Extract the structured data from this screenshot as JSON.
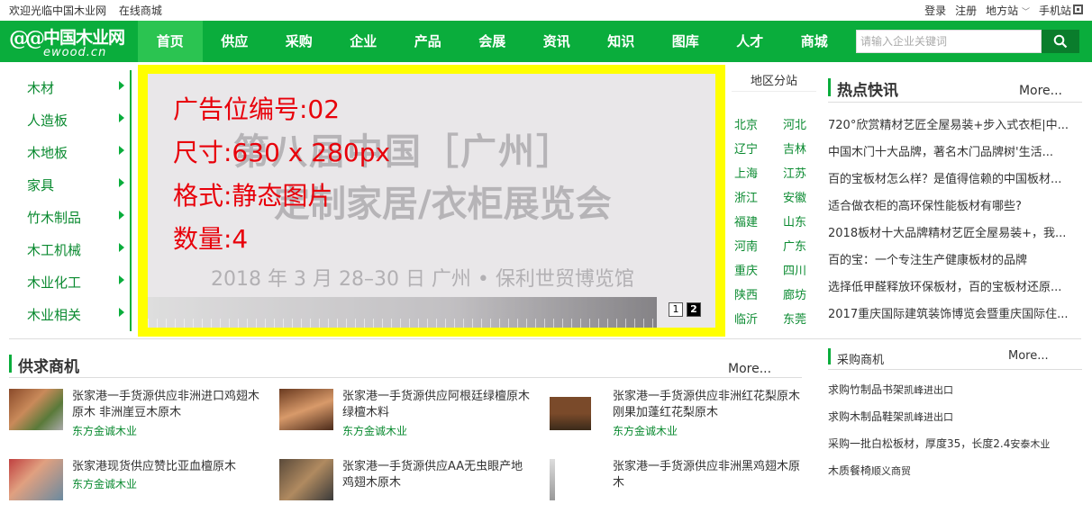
{
  "topbar": {
    "welcome": "欢迎光临中国木业网",
    "mall": "在线商城",
    "login": "登录",
    "register": "注册",
    "region": "地方站",
    "mobile": "手机站"
  },
  "logo": {
    "cn": "中国木业网",
    "en": "ewood.cn"
  },
  "nav": [
    "首页",
    "供应",
    "采购",
    "企业",
    "产品",
    "会展",
    "资讯",
    "知识",
    "图库",
    "人才",
    "商城"
  ],
  "search": {
    "placeholder": "请输入企业关键词"
  },
  "categories": [
    "木材",
    "人造板",
    "木地板",
    "家具",
    "竹木制品",
    "木工机械",
    "木业化工",
    "木业相关"
  ],
  "banner": {
    "lines": [
      "广告位编号:02",
      "尺寸:630 x 280px",
      "格式:静态图片",
      "数量:4"
    ],
    "bg_line1": "第八届中国［广州］",
    "bg_line2": "定制家居/衣柜展览会",
    "bg_line3": "2018 年 3 月 28–30 日   广州 • 保利世贸博览馆",
    "pages": [
      "1",
      "2"
    ]
  },
  "region": {
    "title": "地区分站",
    "items": [
      "北京",
      "河北",
      "辽宁",
      "吉林",
      "上海",
      "江苏",
      "浙江",
      "安徽",
      "福建",
      "山东",
      "河南",
      "广东",
      "重庆",
      "四川",
      "陕西",
      "廊坊",
      "临沂",
      "东莞"
    ]
  },
  "hot": {
    "title": "热点快讯",
    "more": "More...",
    "items": [
      "720°欣赏精材艺匠全屋易装+步入式衣柜|中...",
      "中国木门十大品牌，著名木门品牌树'生活...",
      "百的宝板材怎么样？是值得信赖的中国板材...",
      "适合做衣柜的高环保性能板材有哪些?",
      "2018板材十大品牌精材艺匠全屋易装+，我...",
      "百的宝：一个专注生产健康板材的品牌",
      "选择低甲醛释放环保板材，百的宝板材还原...",
      "2017重庆国际建筑装饰博览会暨重庆国际住..."
    ]
  },
  "supply": {
    "title": "供求商机",
    "more": "More...",
    "items": [
      {
        "title": "张家港一手货源供应非洲进口鸡翅木原木 非洲崖豆木原木",
        "company": "东方金诚木业"
      },
      {
        "title": "张家港一手货源供应阿根廷绿檀原木 绿檀木料",
        "company": "东方金诚木业"
      },
      {
        "title": "张家港一手货源供应非洲红花梨原木刚果加蓬红花梨原木",
        "company": "东方金诚木业"
      },
      {
        "title": "张家港现货供应赞比亚血檀原木",
        "company": "东方金诚木业"
      },
      {
        "title": "张家港一手货源供应AA无虫眼产地鸡翅木原木",
        "company": ""
      },
      {
        "title": "张家港一手货源供应非洲黑鸡翅木原木",
        "company": ""
      }
    ]
  },
  "purchase": {
    "title": "采购商机",
    "more": "More...",
    "items": [
      {
        "text": "求购竹制品书架",
        "company": "凯峰进出口"
      },
      {
        "text": "求购木制品鞋架",
        "company": "凯峰进出口"
      },
      {
        "text": "采购一批白松板材，厚度35，长度2.4",
        "company": "安泰木业"
      },
      {
        "text": "木质餐椅",
        "company": "顺义商贸"
      }
    ]
  },
  "colors": {
    "brand": "#0aad3c",
    "nav_active": "#2bc451",
    "banner_border": "#ffff00",
    "ad_text": "#e8000a"
  }
}
